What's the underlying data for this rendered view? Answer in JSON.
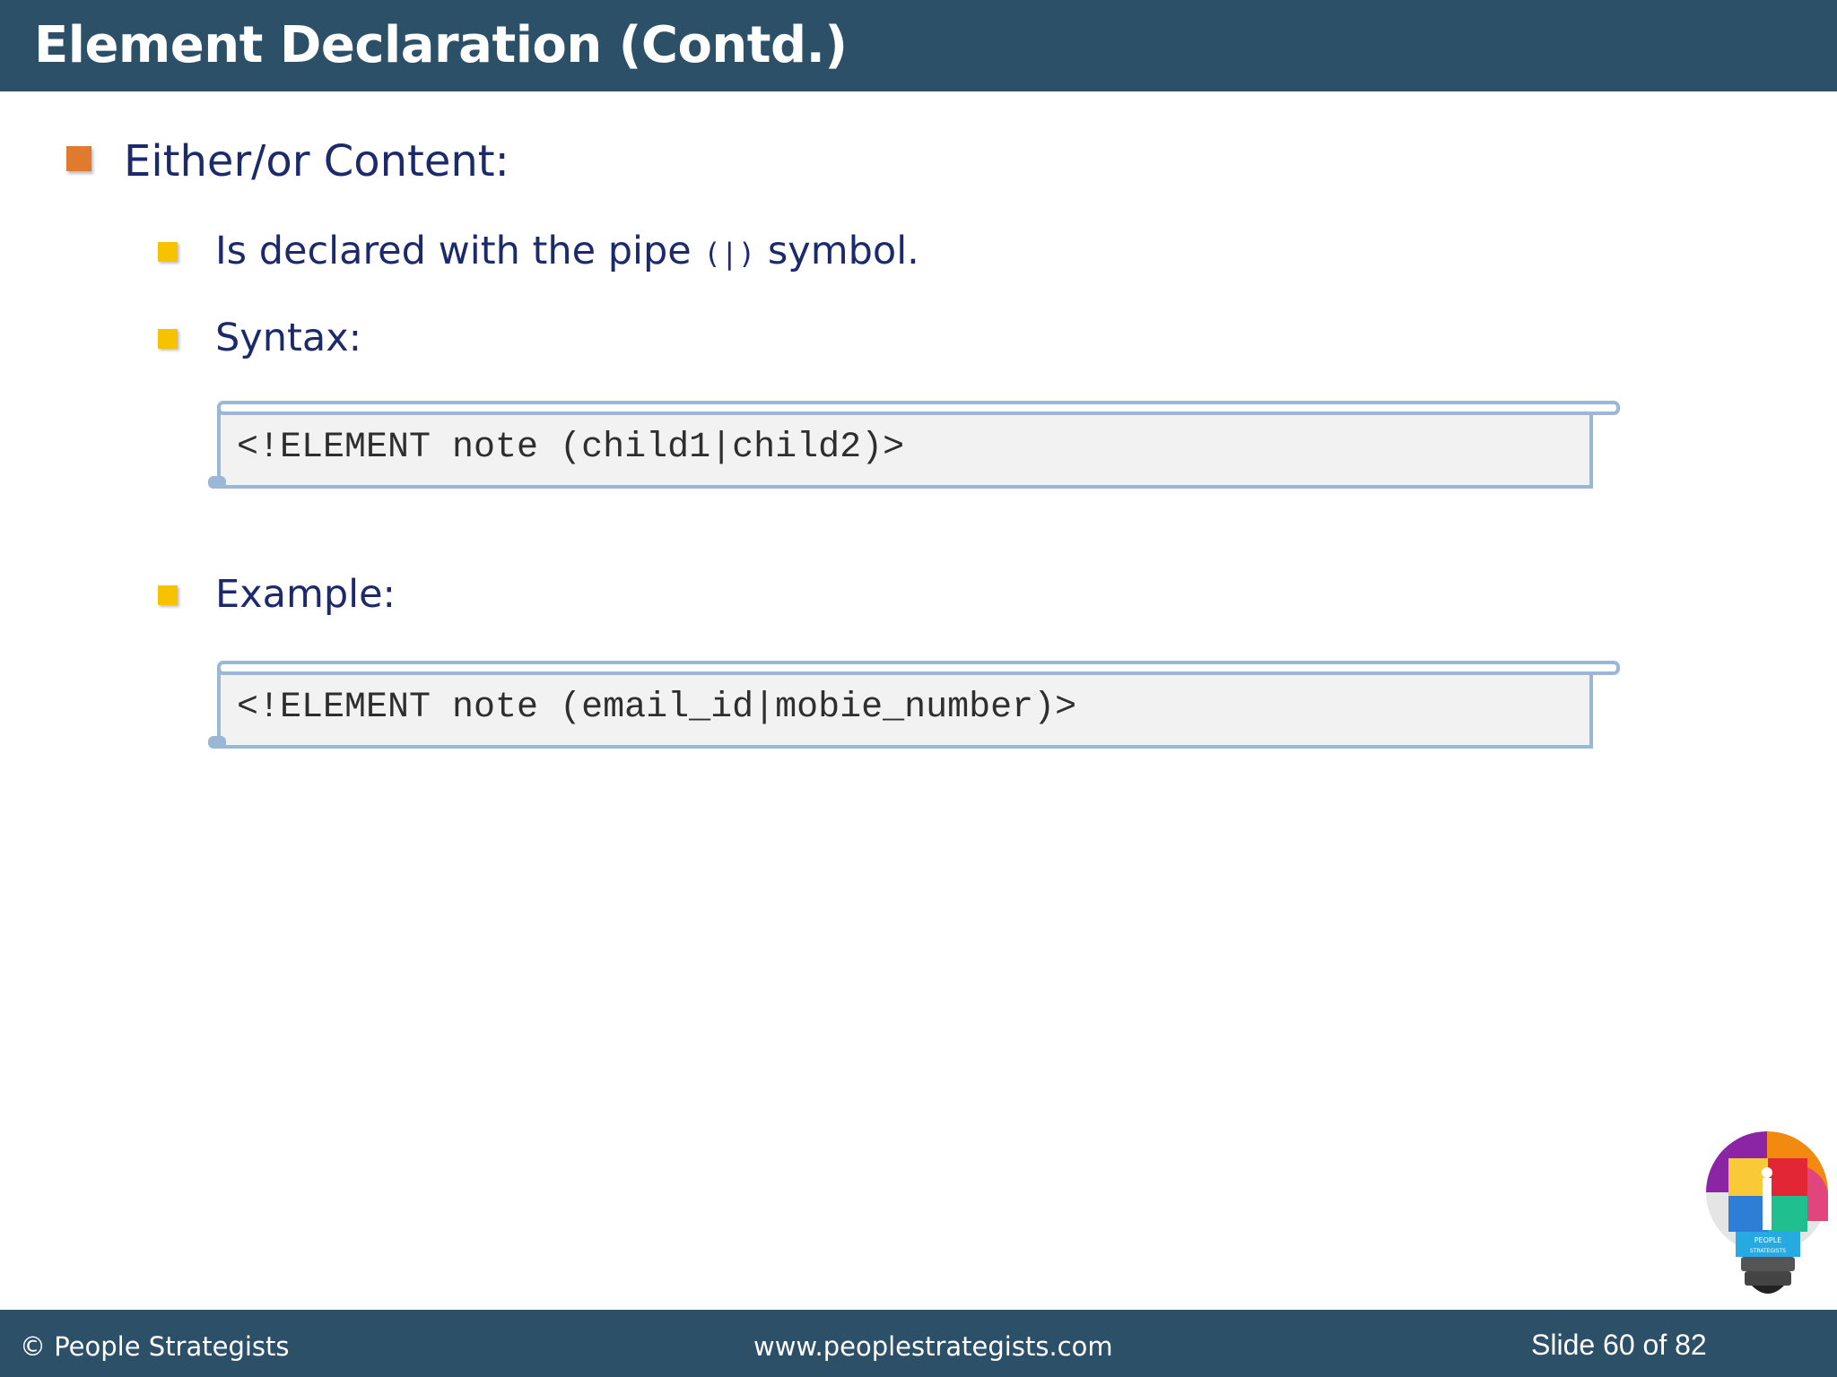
{
  "slide": {
    "title": "Element Declaration (Contd.)",
    "heading": "Either/or Content:",
    "point1": {
      "before": "Is declared with the pipe ",
      "code": "(|)",
      "after": " symbol."
    },
    "syntax_label": "Syntax:",
    "syntax_code": "<!ELEMENT note (child1|child2)>",
    "example_label": "Example:",
    "example_code": "<!ELEMENT note (email_id|mobie_number)>"
  },
  "footer": {
    "copyright": "© People Strategists",
    "website": "www.peoplestrategists.com",
    "slide_counter": "Slide 60 of 82"
  },
  "logo": {
    "text_line1": "PEOPLE",
    "text_line2": "STRATEGISTS",
    "icon": "lightbulb-puzzle-icon"
  },
  "colors": {
    "header_bg": "#2d5069",
    "text": "#1c2a6b",
    "bullet_primary": "#e07a2e",
    "bullet_secondary": "#f7c300",
    "code_border": "#9bb7d6",
    "code_bg": "#f2f2f2"
  }
}
